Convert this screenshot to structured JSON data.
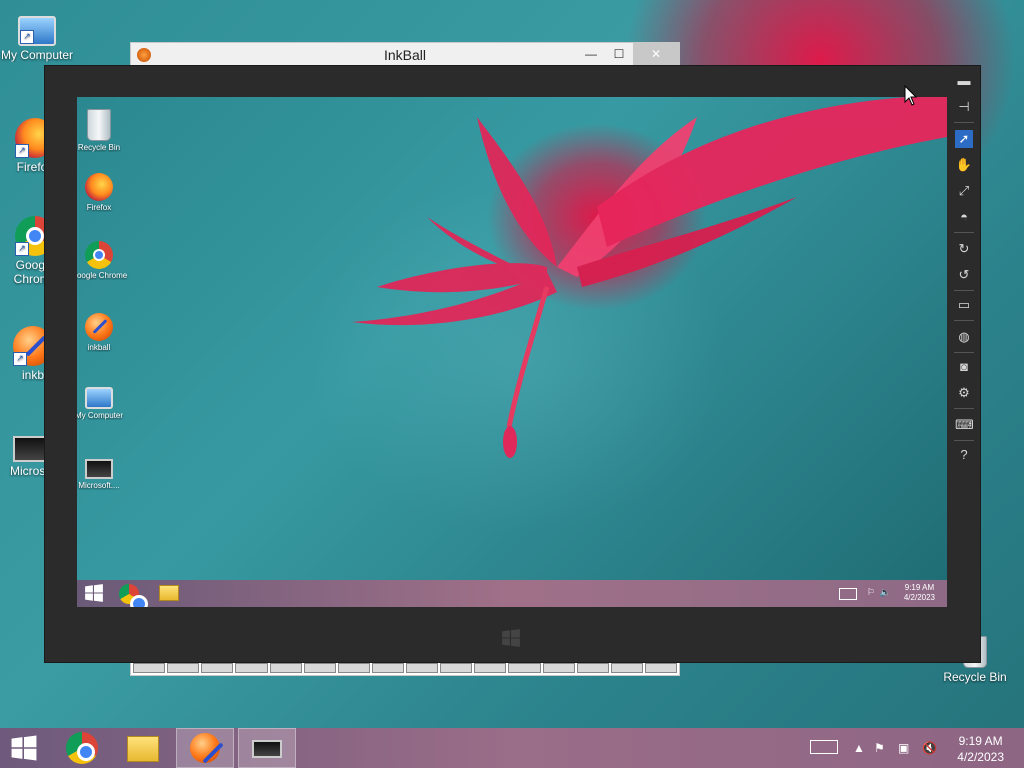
{
  "desktop": {
    "icons": [
      {
        "label": "My Computer",
        "icon": "computer-icon"
      },
      {
        "label": "Firefox",
        "icon": "firefox-icon"
      },
      {
        "label": "Google Chrome",
        "icon": "chrome-icon"
      },
      {
        "label": "inkball",
        "icon": "inkball-icon"
      },
      {
        "label": "Microsoft...",
        "icon": "monitor-icon"
      },
      {
        "label": "Recycle Bin",
        "icon": "recycle-bin-icon"
      }
    ],
    "partial_labels": [
      "My Computer",
      "Firefox",
      "Google",
      "Chrome",
      "inkb",
      "Microso"
    ]
  },
  "inkball_window": {
    "title": "InkBall",
    "minimize": "—",
    "maximize": "☐",
    "close": "✕"
  },
  "remote_viewer": {
    "inner_desktop_icons": [
      {
        "label": "Recycle Bin"
      },
      {
        "label": "Firefox"
      },
      {
        "label": "Google Chrome"
      },
      {
        "label": "inkball"
      },
      {
        "label": "My Computer"
      },
      {
        "label": "Microsoft...."
      }
    ],
    "inner_time": "9:19 AM",
    "inner_date": "4/2/2023",
    "tools": [
      "minimize-icon",
      "pin-icon",
      "pointer-icon",
      "hand-icon",
      "resize-icon",
      "fit-icon",
      "rotate-right-icon",
      "rotate-left-icon",
      "display-icon",
      "globe-icon",
      "camera-icon",
      "settings-icon",
      "keyboard-icon",
      "help-icon"
    ]
  },
  "taskbar": {
    "time": "9:19 AM",
    "date": "4/2/2023"
  }
}
